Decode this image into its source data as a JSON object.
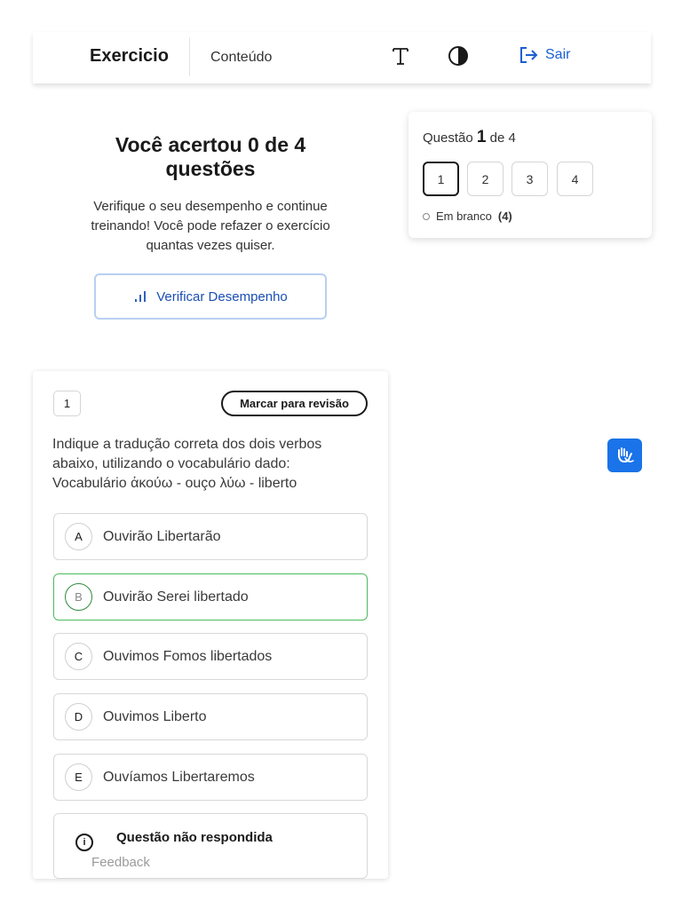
{
  "header": {
    "brand": "Exercicio",
    "nav_content": "Conteúdo",
    "font_icon": "text-size-icon",
    "contrast_icon": "contrast-icon",
    "logout_label": "Sair",
    "accent": "#1b5fcf"
  },
  "result": {
    "title": "Você acertou 0 de 4 questões",
    "description": "Verifique o seu desempenho e continue treinando! Você pode refazer o exercício quantas vezes quiser.",
    "button_label": "Verificar Desempenho"
  },
  "navigator": {
    "label_prefix": "Questão",
    "current": "1",
    "label_suffix": "de 4",
    "questions": [
      "1",
      "2",
      "3",
      "4"
    ],
    "blank_label": "Em branco",
    "blank_count": "(4)"
  },
  "question": {
    "number": "1",
    "review_label": "Marcar para revisão",
    "text": "Indique a tradução correta dos dois verbos abaixo, utilizando o vocabulário dado: Vocabulário ἀκούω - ouço λύω - liberto",
    "options": [
      {
        "letter": "A",
        "text": "Ouvirão Libertarão"
      },
      {
        "letter": "B",
        "text": "Ouvirão Serei libertado"
      },
      {
        "letter": "C",
        "text": "Ouvimos Fomos libertados"
      },
      {
        "letter": "D",
        "text": "Ouvimos Liberto"
      },
      {
        "letter": "E",
        "text": "Ouvíamos Libertaremos"
      }
    ],
    "correct_color": "#4cbb5e",
    "feedback_title": "Questão não respondida",
    "feedback_label": "Feedback"
  },
  "accessibility": {
    "libras_icon": "sign-language-icon",
    "libras_color": "#1a73e8"
  }
}
